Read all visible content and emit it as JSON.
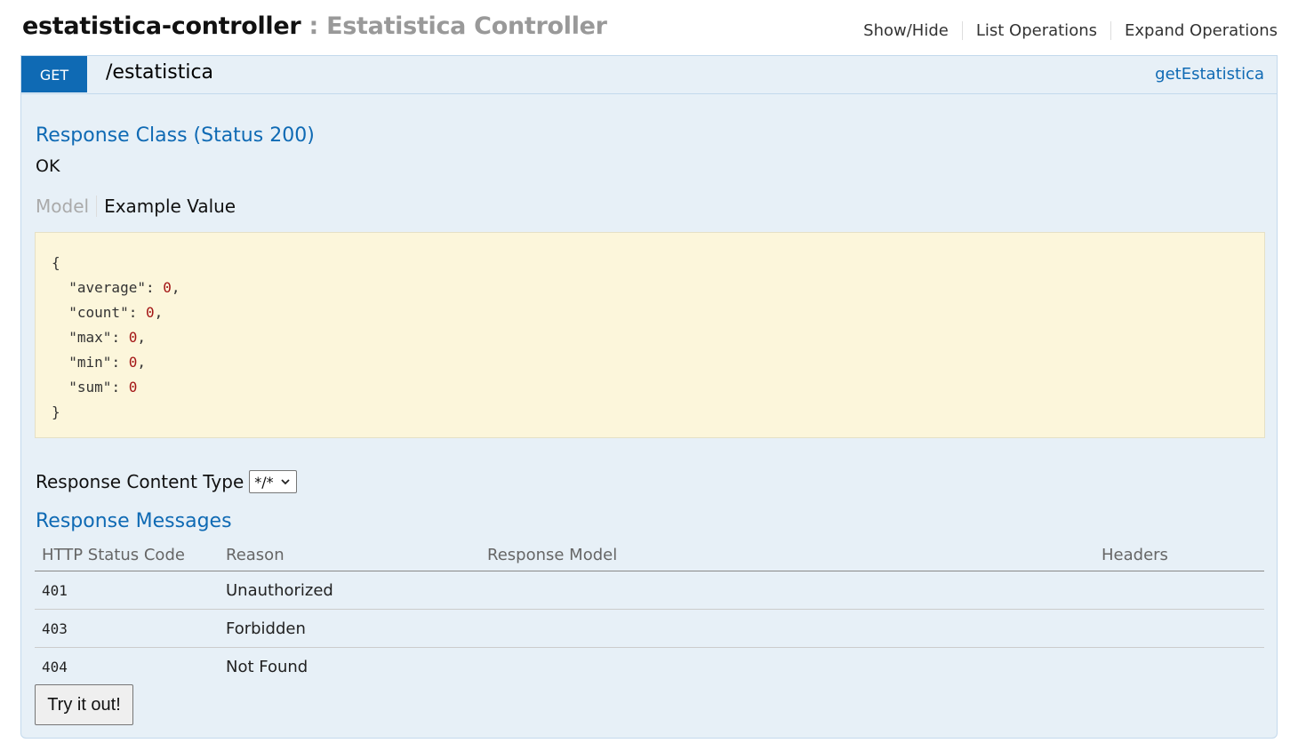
{
  "resource": {
    "name": "estatistica-controller",
    "separator": " : ",
    "description": "Estatistica Controller"
  },
  "actions": {
    "show_hide": "Show/Hide",
    "list_operations": "List Operations",
    "expand_operations": "Expand Operations"
  },
  "operation": {
    "method": "GET",
    "path": "/estatistica",
    "nickname": "getEstatistica",
    "method_color": "#0f6ab4"
  },
  "response_class": {
    "title": "Response Class (Status 200)",
    "value": "OK"
  },
  "signature_tabs": {
    "model": "Model",
    "example": "Example Value"
  },
  "example_json": {
    "open": "{",
    "fields": [
      {
        "key": "\"average\"",
        "value": "0",
        "trail": ","
      },
      {
        "key": "\"count\"",
        "value": "0",
        "trail": ","
      },
      {
        "key": "\"max\"",
        "value": "0",
        "trail": ","
      },
      {
        "key": "\"min\"",
        "value": "0",
        "trail": ","
      },
      {
        "key": "\"sum\"",
        "value": "0",
        "trail": ""
      }
    ],
    "close": "}"
  },
  "response_content_type": {
    "label": "Response Content Type",
    "selected": "*/*"
  },
  "response_messages": {
    "title": "Response Messages",
    "headers": [
      "HTTP Status Code",
      "Reason",
      "Response Model",
      "Headers"
    ],
    "rows": [
      {
        "code": "401",
        "reason": "Unauthorized",
        "model": "",
        "headers": ""
      },
      {
        "code": "403",
        "reason": "Forbidden",
        "model": "",
        "headers": ""
      },
      {
        "code": "404",
        "reason": "Not Found",
        "model": "",
        "headers": ""
      }
    ]
  },
  "try_button": "Try it out!"
}
